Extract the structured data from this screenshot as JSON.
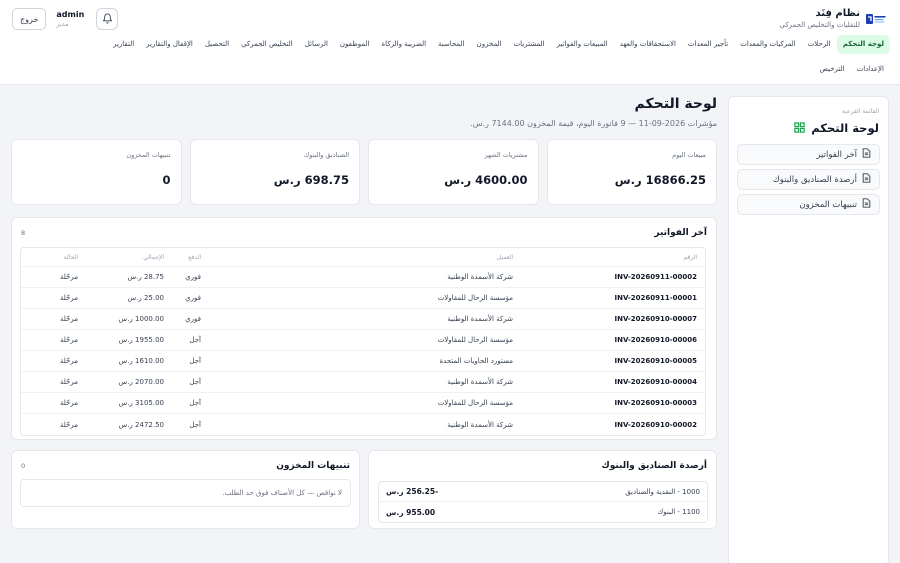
{
  "brand": {
    "name": "نظام فِنَد",
    "subtitle": "للنقليات والتخليص الجمركي"
  },
  "user": {
    "name": "admin",
    "role": "مدير",
    "logout_label": "خروج"
  },
  "nav": {
    "row1": [
      "لوحة التحكم",
      "الرحلات",
      "المركبات والمعدات",
      "تأجير المعدات",
      "الاستحقاقات والعهد",
      "المبيعات والفواتير",
      "المشتريات",
      "المخزون",
      "المحاسبة",
      "الضريبة والزكاة",
      "الموظفون",
      "الرسائل",
      "التخليص الجمركي",
      "التحصيل",
      "الإقفال والتقارير",
      "التقارير"
    ],
    "row2": [
      "الإعدادات",
      "الترخيص"
    ],
    "active": "لوحة التحكم"
  },
  "side": {
    "caption": "القائمة الفرعية",
    "title": "لوحة التحكم",
    "items": [
      "آخر الفواتير",
      "أرصدة الصناديق والبنوك",
      "تنبيهات المخزون"
    ]
  },
  "page": {
    "title": "لوحة التحكم",
    "subtitle": "مؤشرات 2026-09-11 — 9 فاتورة اليوم، قيمة المخزون 7144.00 ر.س."
  },
  "kpis": [
    {
      "label": "مبيعات اليوم",
      "value": "16866.25 ر.س"
    },
    {
      "label": "مشتريات الشهر",
      "value": "4600.00 ر.س"
    },
    {
      "label": "الصناديق والبنوك",
      "value": "698.75 ر.س"
    },
    {
      "label": "تنبيهات المخزون",
      "value": "0"
    }
  ],
  "invoices": {
    "title": "آخر الفواتير",
    "count": "8",
    "columns": [
      "الرقم",
      "العميل",
      "الدفع",
      "الإجمالي",
      "الحالة"
    ],
    "rows": [
      [
        "INV-20260911-00002",
        "شركة الأسمدة الوطنية",
        "فوري",
        "28.75 ر.س",
        "مرحّلة"
      ],
      [
        "INV-20260911-00001",
        "مؤسسة الرحال للمقاولات",
        "فوري",
        "25.00 ر.س",
        "مرحّلة"
      ],
      [
        "INV-20260910-00007",
        "شركة الأسمدة الوطنية",
        "فوري",
        "1000.00 ر.س",
        "مرحّلة"
      ],
      [
        "INV-20260910-00006",
        "مؤسسة الرحال للمقاولات",
        "آجل",
        "1955.00 ر.س",
        "مرحّلة"
      ],
      [
        "INV-20260910-00005",
        "مستورد الحاويات المتحدة",
        "آجل",
        "1610.00 ر.س",
        "مرحّلة"
      ],
      [
        "INV-20260910-00004",
        "شركة الأسمدة الوطنية",
        "آجل",
        "2070.00 ر.س",
        "مرحّلة"
      ],
      [
        "INV-20260910-00003",
        "مؤسسة الرحال للمقاولات",
        "آجل",
        "3105.00 ر.س",
        "مرحّلة"
      ],
      [
        "INV-20260910-00002",
        "شركة الأسمدة الوطنية",
        "آجل",
        "2472.50 ر.س",
        "مرحّلة"
      ]
    ]
  },
  "funds": {
    "title": "أرصدة الصناديق والبنوك",
    "rows": [
      {
        "name": "1000 - النقدية والصناديق",
        "value": "-256.25 ر.س"
      },
      {
        "name": "1100 - البنوك",
        "value": "955.00 ر.س"
      }
    ]
  },
  "stock": {
    "title": "تنبيهات المخزون",
    "count": "0",
    "empty": "لا نواقص — كل الأصناف فوق حد الطلب."
  },
  "colors": {
    "active_bg": "#dcfce7",
    "active_text": "#166534",
    "brand_blue": "#1e40af"
  },
  "icons": {
    "bell": "bell-icon",
    "grid": "grid-icon",
    "doc": "document-icon",
    "logo": "logo-icon"
  }
}
